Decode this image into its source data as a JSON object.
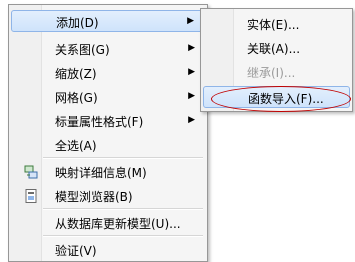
{
  "main_menu": {
    "items": [
      {
        "label": "添加(D)",
        "submenu": true,
        "highlighted": true
      },
      {
        "label": "关系图(G)",
        "submenu": true
      },
      {
        "label": "缩放(Z)",
        "submenu": true
      },
      {
        "label": "网格(G)",
        "submenu": true
      },
      {
        "label": "标量属性格式(F)",
        "submenu": true
      },
      {
        "label": "全选(A)"
      },
      {
        "label": "映射详细信息(M)",
        "icon": "mapping-details-icon"
      },
      {
        "label": "模型浏览器(B)",
        "icon": "model-browser-icon"
      },
      {
        "label": "从数据库更新模型(U)..."
      },
      {
        "label": "验证(V)"
      }
    ]
  },
  "sub_menu": {
    "items": [
      {
        "label": "实体(E)..."
      },
      {
        "label": "关联(A)..."
      },
      {
        "label": "继承(I)...",
        "disabled": true
      },
      {
        "label": "函数导入(F)...",
        "highlighted": true
      }
    ]
  },
  "colors": {
    "highlight": "#cfe3fb",
    "highlight_border": "#8fb5e8",
    "annotation_oval": "#c00000"
  }
}
